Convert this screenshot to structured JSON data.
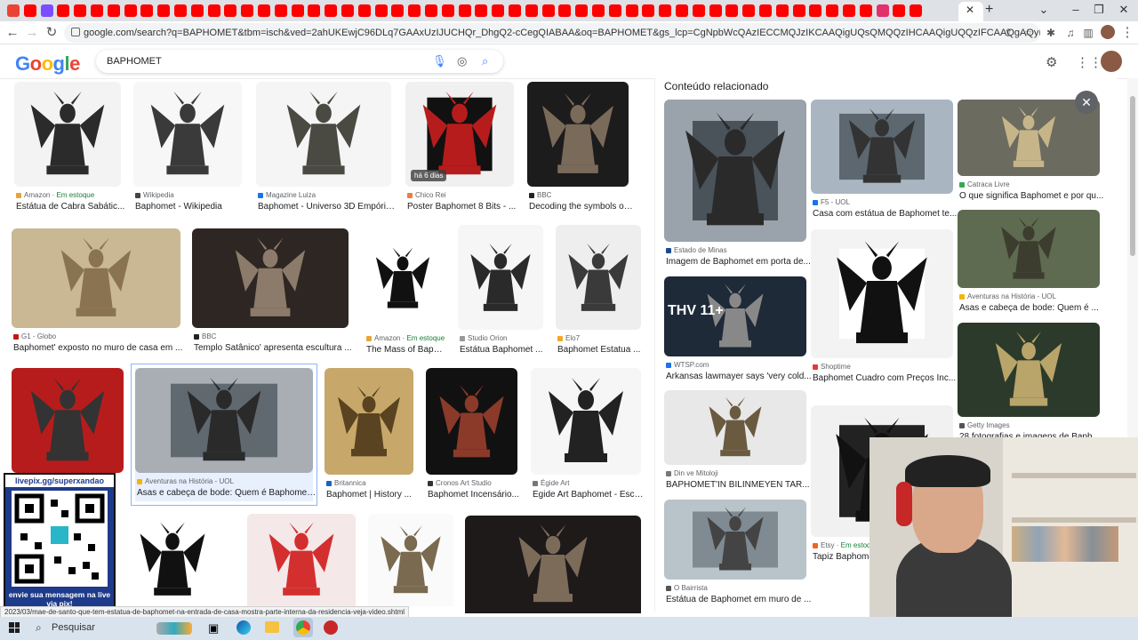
{
  "browser": {
    "url": "google.com/search?q=BAPHOMET&tbm=isch&ved=2ahUKEwjC96DLq7GAAxUzIJUCHQr_DhgQ2-cCegQIABAA&oq=BAPHOMET&gs_lcp=CgNpbWcQAzIECCMQJzIKCAAQigUQsQMQQzIHCAAQigUQQzIFCAAQgAQyBQgAEIAEMgUIABCABDIHCAAQi...",
    "tab_colors": [
      "#ea4335",
      "#7c4dff",
      "#ff0000",
      "#e1306c"
    ],
    "status_url": "2023/03/mae-de-santo-que-tem-estatua-de-baphomet-na-entrada-de-casa-mostra-parte-interna-da-residencia-veja-video.shtml"
  },
  "google": {
    "logo": "Google",
    "query": "BAPHOMET"
  },
  "results": [
    {
      "src": "Amazon",
      "stock": "Em estoque",
      "title": "Estátua de Cabra Sabátic...",
      "fav": "#e8a33d"
    },
    {
      "src": "Wikipedia",
      "title": "Baphomet - Wikipedia",
      "fav": "#444"
    },
    {
      "src": "Magazine Luiza",
      "title": "Baphomet - Universo 3D Empório...",
      "fav": "#1a73e8"
    },
    {
      "src": "Chico Rei",
      "title": "Poster Baphomet 8 Bits - ...",
      "badge": "há 6 dias",
      "fav": "#f07b3f"
    },
    {
      "src": "BBC",
      "title": "Decoding the symbols on S...",
      "fav": "#222"
    },
    {
      "src": "G1 - Globo",
      "title": "Baphomet' exposto no muro de casa em ...",
      "fav": "#c4170c"
    },
    {
      "src": "BBC",
      "title": "Templo Satânico' apresenta escultura ...",
      "fav": "#222"
    },
    {
      "src": "Amazon",
      "stock": "Em estoque",
      "title": "The Mass of Bapho...",
      "fav": "#e8a33d"
    },
    {
      "src": "Studio Orion",
      "title": "Estátua Baphomet ...",
      "fav": "#999"
    },
    {
      "src": "Elo7",
      "title": "Baphomet Estatua ...",
      "fav": "#f6a623"
    },
    {
      "src": "",
      "title": "",
      "fav": "#999"
    },
    {
      "src": "Aventuras na História - UOL",
      "title": "Asas e cabeça de bode: Quem é Baphomet, ...",
      "fav": "#f2b705"
    },
    {
      "src": "Britannica",
      "title": "Baphomet | History ...",
      "fav": "#1565c0"
    },
    {
      "src": "Cronos Art Studio",
      "title": "Baphomet Incensário...",
      "fav": "#333"
    },
    {
      "src": "Égide Art",
      "title": "Égide Art Baphomet - Escu...",
      "fav": "#777"
    }
  ],
  "panel": {
    "title": "Conteúdo relacionado",
    "items": [
      {
        "src": "Estado de Minas",
        "title": "Imagem de Baphomet em porta de...",
        "fav": "#1a4b8c"
      },
      {
        "src": "F5 - UOL",
        "title": "Casa com estátua de Baphomet te...",
        "fav": "#1a73e8"
      },
      {
        "src": "Catraca Livre",
        "title": "O que significa Baphomet e por qu...",
        "fav": "#34a853"
      },
      {
        "src": "WTSP.com",
        "title": "Arkansas lawmayer says 'very cold...",
        "fav": "#1a73e8"
      },
      {
        "src": "Shoptime",
        "title": "Baphomet Cuadro com Preços Inc...",
        "fav": "#e53935"
      },
      {
        "src": "Aventuras na História - UOL",
        "title": "Asas e cabeça de bode: Quem é ...",
        "fav": "#f2b705"
      },
      {
        "src": "Getty Images",
        "title": "28 fotografias e imagens de Baph...",
        "fav": "#555"
      },
      {
        "src": "Din ve Mitoloji",
        "title": "BAPHOMET'IN BİLİNMEYEN TAR...",
        "fav": "#777"
      },
      {
        "src": "O Bairrista",
        "title": "Estátua de Baphomet em muro de ...",
        "fav": "#555"
      },
      {
        "src": "Etsy",
        "stock": "Em estoque",
        "title": "Tapiz Baphomet",
        "fav": "#f1641e"
      }
    ],
    "overlay_text": "THV 11+"
  },
  "overlay": {
    "qr_url": "livepix.gg/superxandao",
    "qr_msg": "envie sua mensagem na live via pix!"
  },
  "taskbar": {
    "search_label": "Pesquisar"
  }
}
